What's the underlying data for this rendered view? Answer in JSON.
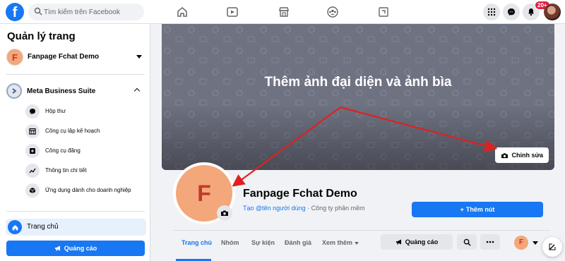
{
  "topbar": {
    "logo_letter": "f",
    "search_placeholder": "Tìm kiếm trên Facebook",
    "nav_tabs": [
      "home-icon",
      "video-icon",
      "marketplace-icon",
      "groups-icon",
      "gaming-icon"
    ],
    "right_icons": [
      "menu-grid-icon",
      "messenger-icon",
      "bell-icon"
    ],
    "notification_badge": "20+"
  },
  "sidebar": {
    "title": "Quản lý trang",
    "page": {
      "avatar_letter": "F",
      "name": "Fanpage Fchat Demo"
    },
    "business_suite": {
      "label": "Meta Business Suite",
      "items": [
        {
          "label": "Hộp thư",
          "icon": "inbox-icon"
        },
        {
          "label": "Công cụ lập kế hoạch",
          "icon": "calendar-icon"
        },
        {
          "label": "Công cụ đăng",
          "icon": "publishing-icon"
        },
        {
          "label": "Thông tin chi tiết",
          "icon": "insights-icon"
        },
        {
          "label": "Ứng dụng dành cho doanh nghiệp",
          "icon": "cube-icon"
        }
      ]
    },
    "home_label": "Trang chủ",
    "ads_button": "Quảng cáo"
  },
  "main": {
    "cover_text": "Thêm ảnh đại diện và ảnh bìa",
    "edit_cover_button": "Chỉnh sửa",
    "avatar_letter": "F",
    "page_title": "Fanpage Fchat Demo",
    "username_link": "Tạo @tên người dùng",
    "category": " · Công ty phần mềm",
    "add_button": "Thêm nút",
    "tabs": [
      {
        "label": "Trang chủ",
        "active": true
      },
      {
        "label": "Nhóm",
        "active": false
      },
      {
        "label": "Sự kiện",
        "active": false
      },
      {
        "label": "Đánh giá",
        "active": false
      },
      {
        "label": "Xem thêm",
        "active": false
      }
    ],
    "ads_button": "Quảng cáo",
    "small_avatar_letter": "F"
  },
  "colors": {
    "brand": "#1877f2",
    "cover": "#6e7281",
    "avatar": "#f4a77a",
    "arrow": "#e02020"
  }
}
